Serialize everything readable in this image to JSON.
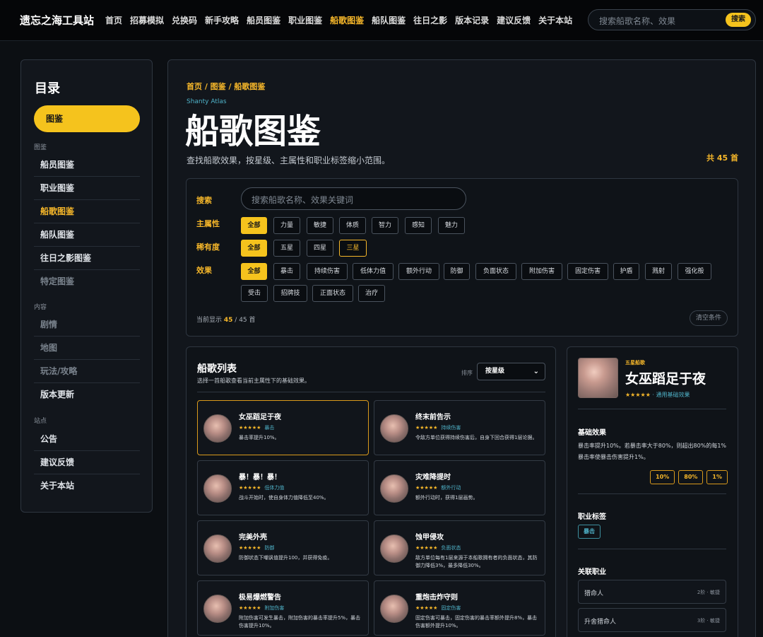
{
  "site": {
    "brand": "遗忘之海工具站",
    "nav": [
      "首页",
      "招募模拟",
      "兑换码",
      "新手攻略",
      "船员图鉴",
      "职业图鉴",
      "船歌图鉴",
      "船队图鉴",
      "往日之影",
      "版本记录",
      "建议反馈",
      "关于本站"
    ],
    "active_nav": "船歌图鉴",
    "search_placeholder": "搜索船歌名称、效果",
    "search_button": "搜索"
  },
  "sidebar": {
    "title": "目录",
    "active_item": "图鉴",
    "sections": [
      {
        "label": "图鉴",
        "items": [
          "船员图鉴",
          "职业图鉴",
          "船歌图鉴",
          "船队图鉴",
          "往日之影图鉴",
          "特定图鉴"
        ]
      },
      {
        "label": "内容",
        "items": [
          "剧情",
          "地图",
          "玩法/攻略",
          "版本更新"
        ]
      },
      {
        "label": "站点",
        "items": [
          "公告",
          "建议反馈",
          "关于本站"
        ]
      }
    ]
  },
  "page": {
    "breadcrumb": "首页 / 图鉴 / 船歌图鉴",
    "subtitle_en": "Shanty Atlas",
    "title": "船歌图鉴",
    "description": "查找船歌效果，按星级、主属性和职业标签缩小范围。",
    "total": "共 45 首"
  },
  "filters": {
    "search_label": "搜索",
    "search_placeholder": "搜索船歌名称、效果关键词",
    "attr_label": "主属性",
    "attr_options": [
      "全部",
      "力量",
      "敏捷",
      "体质",
      "智力",
      "感知",
      "魅力"
    ],
    "rarity_label": "稀有度",
    "rarity_options": [
      "全部",
      "五星",
      "四星",
      "三星"
    ],
    "effect_label": "效果",
    "effect_options": [
      "全部",
      "暴击",
      "持续伤害",
      "低体力值",
      "额外行动",
      "防御",
      "负面状态",
      "附加伤害",
      "固定伤害",
      "护盾",
      "溅射",
      "强化般",
      "受击",
      "招牌技",
      "正面状态",
      "治疗"
    ],
    "count_prefix": "当前显示",
    "count_shown": "45",
    "count_suffix": "/ 45 首",
    "clear_button": "清空条件"
  },
  "list": {
    "title": "船歌列表",
    "subtitle": "选择一首船歌查看当前主属性下的基础效果。",
    "sort_label": "排序",
    "sort_value": "按星级",
    "items": [
      {
        "name": "女巫蹈足于夜",
        "stars": "★★★★★",
        "tag": "暴击",
        "effect": "暴击率提升10%。"
      },
      {
        "name": "终末前告示",
        "stars": "★★★★★",
        "tag": "持续伤害",
        "effect": "令敌方单位获得持续伤害后，自身下回合获得1层论据。"
      },
      {
        "name": "暴！暴！暴！",
        "stars": "★★★★★",
        "tag": "低体力值",
        "effect": "战斗开始时，使自身体力值降低至40%。"
      },
      {
        "name": "灾难降提时",
        "stars": "★★★★★",
        "tag": "额外行动",
        "effect": "额外行动时，获得1层画势。"
      },
      {
        "name": "完美外壳",
        "stars": "★★★★★",
        "tag": "防御",
        "effect": "防御状态下嘲讽值提升100，并获得免疫。"
      },
      {
        "name": "蚀甲侵攻",
        "stars": "★★★★★",
        "tag": "负面状态",
        "effect": "敌方单位每有1层来源于本船歌拥有者的负面状态，其防御力降低3%，最多降低30%。"
      },
      {
        "name": "极易爆燃警告",
        "stars": "★★★★★",
        "tag": "附加伤害",
        "effect": "附加伤害可发生暴击，附加伤害的暴击率提升5%，暴击伤害提升10%。"
      },
      {
        "name": "重炮击炸守则",
        "stars": "★★★★★",
        "tag": "固定伤害",
        "effect": "固定伤害可暴击，固定伤害的暴击率额外提升8%，暴击伤害额外提升10%。"
      }
    ]
  },
  "detail": {
    "rank": "五星船歌",
    "name": "女巫蹈足于夜",
    "stars": "★★★★★",
    "tag_line": " · 通用基础效果",
    "base_heading": "基础效果",
    "base_text": "暴击率提升10%。若暴击率大于80%，则超出80%的每1%暴击率使暴击伤害提升1%。",
    "values": [
      "10%",
      "80%",
      "1%"
    ],
    "job_heading": "职业标签",
    "job_tag": "暴击",
    "related_heading": "关联职业",
    "related": [
      {
        "name": "猎命人",
        "meta": "2阶 · 敏捷"
      },
      {
        "name": "升舍猎命人",
        "meta": "3阶 · 敏捷"
      }
    ]
  }
}
